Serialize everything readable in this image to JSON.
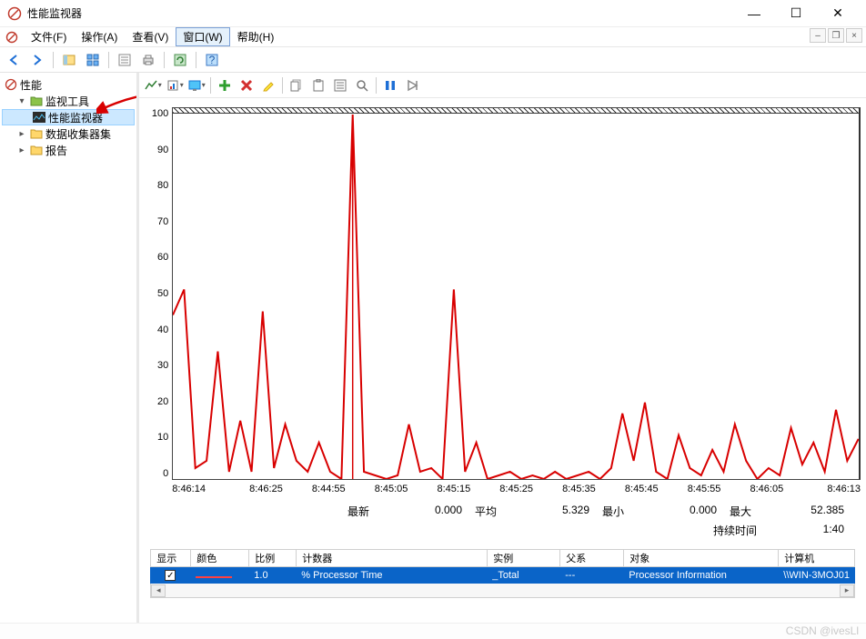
{
  "window": {
    "title": "性能监视器"
  },
  "menu": {
    "file": "文件(F)",
    "action": "操作(A)",
    "view": "查看(V)",
    "window": "窗口(W)",
    "help": "帮助(H)"
  },
  "tree": {
    "root": "性能",
    "n1": "监视工具",
    "n1a": "性能监视器",
    "n2": "数据收集器集",
    "n3": "报告"
  },
  "stats": {
    "latest_lbl": "最新",
    "latest": "0.000",
    "avg_lbl": "平均",
    "avg": "5.329",
    "min_lbl": "最小",
    "min": "0.000",
    "max_lbl": "最大",
    "max": "52.385",
    "dur_lbl": "持续时间",
    "dur": "1:40"
  },
  "legend": {
    "h_show": "显示",
    "h_color": "颜色",
    "h_scale": "比例",
    "h_counter": "计数器",
    "h_instance": "实例",
    "h_parent": "父系",
    "h_object": "对象",
    "h_computer": "计算机",
    "r_scale": "1.0",
    "r_counter": "% Processor Time",
    "r_instance": "_Total",
    "r_parent": "---",
    "r_object": "Processor Information",
    "r_computer": "\\\\WIN-3MOJ01"
  },
  "watermark": "CSDN @ivesLl",
  "chart_data": {
    "type": "line",
    "ylim": [
      0,
      100
    ],
    "yticks": [
      0,
      10,
      20,
      30,
      40,
      50,
      60,
      70,
      80,
      90,
      100
    ],
    "xlabels": [
      "8:46:14",
      "8:46:25",
      "8:44:55",
      "8:45:05",
      "8:45:15",
      "8:45:25",
      "8:45:35",
      "8:45:45",
      "8:45:55",
      "8:46:05",
      "8:46:13"
    ],
    "series": [
      {
        "name": "% Processor Time",
        "color": "#d80000",
        "values": [
          45,
          52,
          3,
          5,
          35,
          2,
          16,
          2,
          46,
          3,
          15,
          5,
          2,
          10,
          2,
          0,
          100,
          2,
          1,
          0,
          1,
          15,
          2,
          3,
          0,
          52,
          2,
          10,
          0,
          1,
          2,
          0,
          1,
          0,
          2,
          0,
          1,
          2,
          0,
          3,
          18,
          5,
          21,
          2,
          0,
          12,
          3,
          1,
          8,
          2,
          15,
          5,
          0,
          3,
          1,
          14,
          4,
          10,
          2,
          19,
          5,
          11
        ]
      }
    ]
  }
}
